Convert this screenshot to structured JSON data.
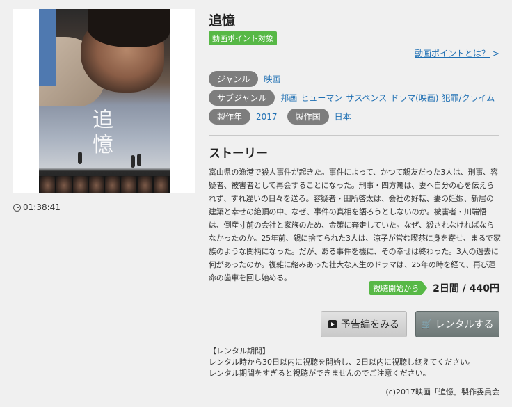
{
  "movie": {
    "title": "追憶",
    "poster_title": "追\n憶",
    "duration": "01:38:41"
  },
  "badges": {
    "point_target": "動画ポイント対象",
    "point_link": "動画ポイントとは？",
    "point_link_arrow": ">"
  },
  "meta": {
    "genre_label": "ジャンル",
    "genre_value": "映画",
    "subgenre_label": "サブジャンル",
    "subgenre_values": [
      "邦画",
      "ヒューマン",
      "サスペンス",
      "ドラマ(映画)",
      "犯罪/クライム"
    ],
    "year_label": "製作年",
    "year_value": "2017",
    "country_label": "製作国",
    "country_value": "日本"
  },
  "story": {
    "heading": "ストーリー",
    "text": "富山県の漁港で殺人事件が起きた。事件によって、かつて親友だった3人は、刑事、容疑者、被害者として再会することになった。刑事・四方篤は、妻へ自分の心を伝えられず、すれ違いの日々を送る。容疑者・田所啓太は、会社の好転、妻の妊娠、新居の建築と幸せの絶頂の中、なぜ、事件の真相を語ろうとしないのか。被害者・川端悟は、倒産寸前の会社と家族のため、金策に奔走していた。なぜ、殺されなければならなかったのか。25年前、親に捨てられた3人は、涼子が営む喫茶に身を寄せ、まるで家族のような関柄になった。だが、ある事件を機に、その幸せは終わった。3人の過去に何があったのか。複雑に絡みあった壮大な人生のドラマは、25年の時を経て、再び運命の歯車を回し始める。"
  },
  "pricing": {
    "badge": "視聴開始から",
    "price": "2日間 / 440円"
  },
  "buttons": {
    "trailer": "予告編をみる",
    "rent": "レンタルする"
  },
  "rental_info": {
    "heading": "【レンタル期間】",
    "line1": "レンタル時から30日以内に視聴を開始し、2日以内に視聴し終えてください。",
    "line2": "レンタル期間をすぎると視聴ができませんのでご注意ください。"
  },
  "copyright": "(c)2017映画「追憶」製作委員会",
  "colors": {
    "green_badge": "#57b846",
    "link_blue": "#1e6fb3",
    "pill_gray": "#7d7d7d",
    "rent_button": "#6d7776"
  },
  "icons": {
    "clock": "clock-icon",
    "play": "play-icon",
    "cart": "cart-icon"
  }
}
